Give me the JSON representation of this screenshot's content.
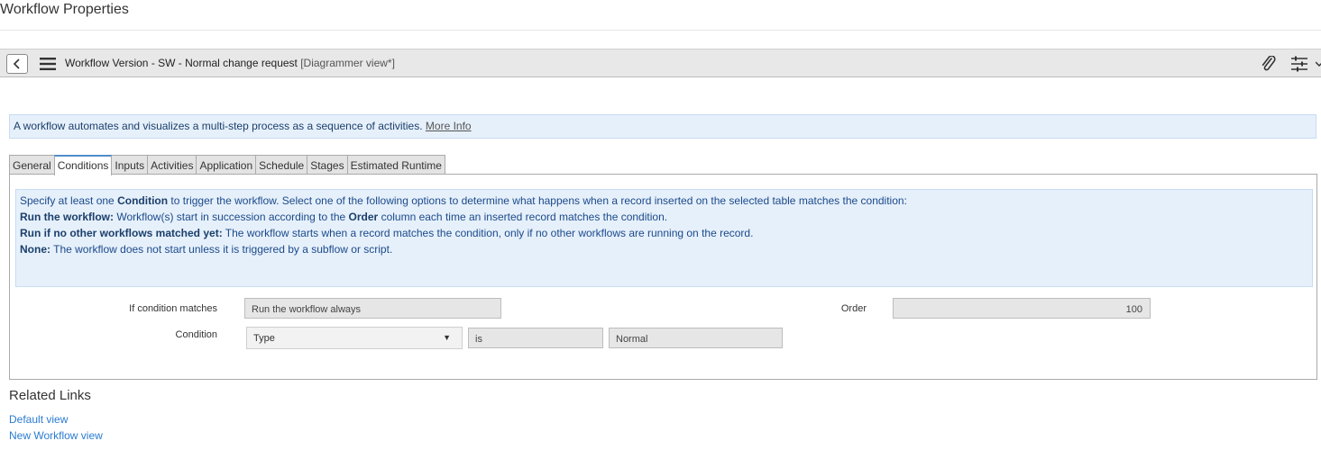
{
  "page_title": "Workflow Properties",
  "header": {
    "record_title": "Workflow Version - SW - Normal change request",
    "view_label": "[Diagrammer view*]"
  },
  "info": {
    "text": "A workflow automates and visualizes a multi-step process as a sequence of activities.",
    "more_info": "More Info"
  },
  "tabs": [
    "General",
    "Conditions",
    "Inputs",
    "Activities",
    "Application",
    "Schedule",
    "Stages",
    "Estimated Runtime"
  ],
  "active_tab": "Conditions",
  "help": {
    "line1_a": "Specify at least one ",
    "line1_b": "Condition",
    "line1_c": " to trigger the workflow. Select one of the following options to determine what happens when a record inserted on the selected table matches the condition:",
    "line2_bold": "Run the workflow:",
    "line2_a": " Workflow(s) start in succession according to the ",
    "line2_b": "Order",
    "line2_c": " column each time an inserted record matches the condition.",
    "line3_bold": "Run if no other workflows matched yet:",
    "line3_rest": " The workflow starts when a record matches the condition, only if no other workflows are running on the record.",
    "line4_bold": "None:",
    "line4_rest": " The workflow does not start unless it is triggered by a subflow or script."
  },
  "form": {
    "if_condition_label": "If condition matches",
    "if_condition_value": "Run the workflow always",
    "order_label": "Order",
    "order_value": "100",
    "condition_label": "Condition",
    "condition_field": "Type",
    "condition_operator": "is",
    "condition_value": "Normal"
  },
  "related_links": {
    "title": "Related Links",
    "items": [
      "Default view",
      "New Workflow view"
    ]
  },
  "icons": [
    "chevron-left-icon",
    "hamburger-menu-icon",
    "paperclip-icon",
    "sliders-icon",
    "caret-down-icon"
  ],
  "colors": {
    "info_bg": "#e6f0fb",
    "link_blue": "#2a7bd1",
    "tab_active_accent": "#4f8cc9"
  }
}
